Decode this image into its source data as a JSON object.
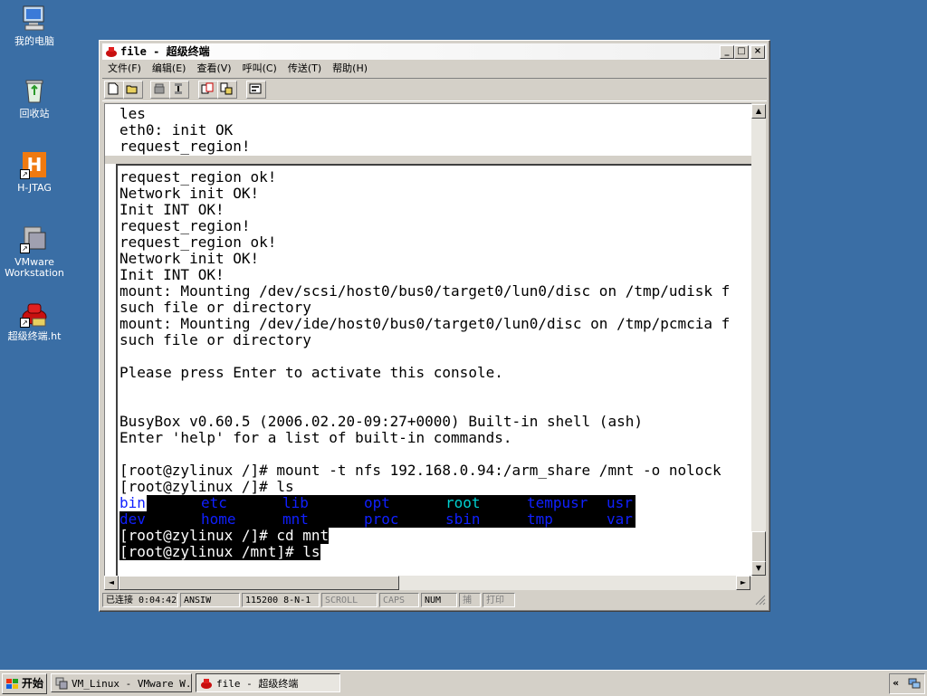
{
  "desktop": {
    "icons": [
      {
        "label": "我的电脑"
      },
      {
        "label": "回收站"
      },
      {
        "label": "H-JTAG"
      },
      {
        "label_line1": "VMware",
        "label_line2": "Workstation"
      },
      {
        "label": "超级终端.ht"
      }
    ]
  },
  "window": {
    "title": "file - 超级终端",
    "controls": {
      "minimize": "_",
      "maximize": "□",
      "close": "×"
    },
    "menu": [
      "文件(F)",
      "编辑(E)",
      "查看(V)",
      "呼叫(C)",
      "传送(T)",
      "帮助(H)"
    ],
    "terminal": {
      "history": [
        "les",
        "eth0: init OK",
        "request_region!"
      ],
      "lines": [
        "request_region ok!",
        "Network init OK!",
        "Init INT OK!",
        "request_region!",
        "request_region ok!",
        "Network init OK!",
        "Init INT OK!",
        "mount: Mounting /dev/scsi/host0/bus0/target0/lun0/disc on /tmp/udisk f",
        "such file or directory",
        "mount: Mounting /dev/ide/host0/bus0/target0/lun0/disc on /tmp/pcmcia f",
        "such file or directory",
        "",
        "Please press Enter to activate this console.",
        "",
        "",
        "BusyBox v0.60.5 (2006.02.20-09:27+0000) Built-in shell (ash)",
        "Enter 'help' for a list of built-in commands.",
        "",
        "[root@zylinux /]# mount -t nfs 192.168.0.94:/arm_share /mnt -o nolock",
        "[root@zylinux /]# ls"
      ],
      "ls_row1": [
        "bin",
        "etc",
        "lib",
        "opt",
        "root",
        "tempusr",
        "usr"
      ],
      "ls_row2": [
        "dev",
        "home",
        "mnt",
        "proc",
        "sbin",
        "tmp",
        "var"
      ],
      "cmd_cd": "[root@zylinux /]# cd mnt",
      "cmd_ls": "[root@zylinux /mnt]# ls"
    },
    "scroll": {
      "up": "▲",
      "down": "▼",
      "left": "◄",
      "right": "►"
    },
    "status": {
      "connected": "已连接 0:04:42",
      "emulation": "ANSIW",
      "settings": "115200 8-N-1",
      "scroll": "SCROLL",
      "caps": "CAPS",
      "num": "NUM",
      "capture": "捕",
      "print": "打印"
    }
  },
  "taskbar": {
    "start": "开始",
    "tasks": [
      {
        "label": "VM_Linux - VMware W..."
      },
      {
        "label": "file - 超级终端"
      }
    ],
    "tray_chevron": "«"
  },
  "colors": {
    "desktop": "#3a6ea5",
    "ls_dir": "#1020ff",
    "ls_exec": "#00d0d0"
  }
}
